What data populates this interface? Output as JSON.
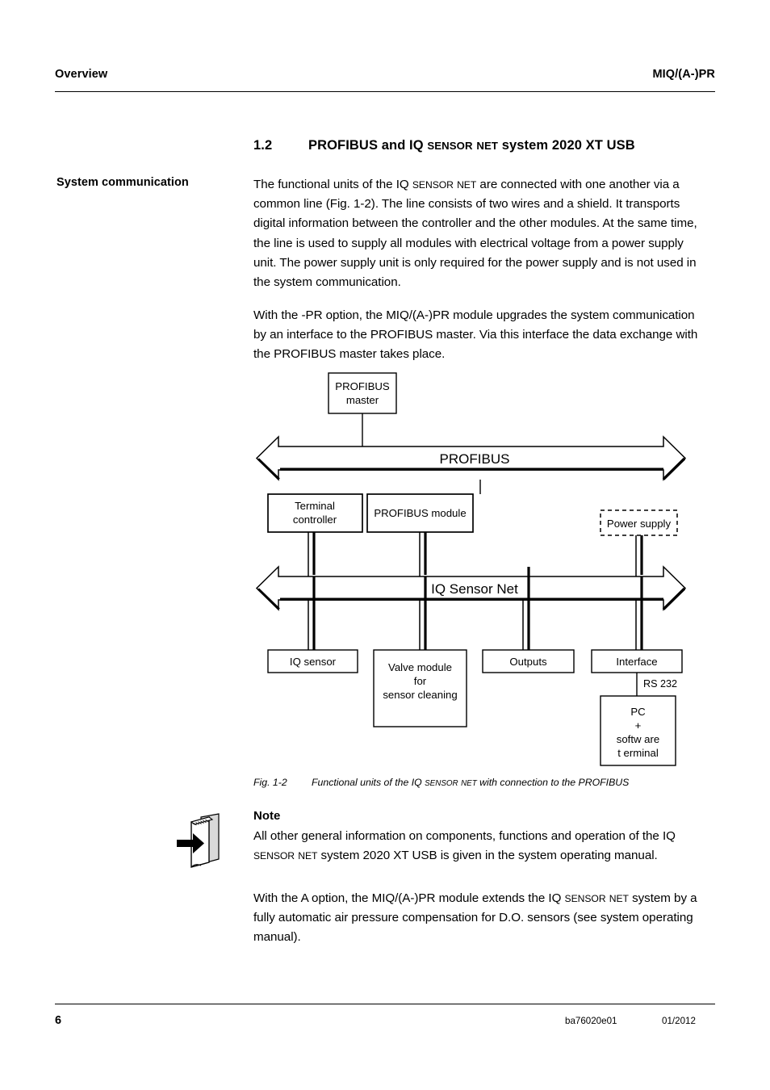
{
  "header": {
    "left": "Overview",
    "right": "MIQ/(A-)PR"
  },
  "heading": {
    "number": "1.2",
    "text_part1": "PROFIBUS and IQ ",
    "text_smallcaps1": "SENSOR",
    "text_part2": " ",
    "text_smallcaps2": "NET",
    "text_part3": " system 2020 XT USB",
    "full": "1.2 PROFIBUS and IQ SENSOR NET system 2020 XT USB"
  },
  "margin_label": "System communication",
  "paragraphs": {
    "p1": "The functional units of the IQ SENSOR NET are connected with one another via a common line (Fig. 1-2). The line consists of two wires and a shield. It transports digital information between the controller and the other modules. At the same time, the line is used to supply all modules with electrical voltage from a power supply unit. The power supply unit is only required for the power supply and is not used in the system communication.",
    "p2": "With the -PR option, the MIQ/(A-)PR module upgrades the system communication by an interface to the PROFIBUS master. Via this interface the data exchange with the PROFIBUS master takes place.",
    "p3": "All other general information on components, functions and operation of the IQ SENSOR NET system 2020 XT USB is given in the system operating manual.",
    "p4": "With the A option, the MIQ/(A-)PR module extends the IQ SENSOR NET system by a fully automatic air pressure compensation for D.O. sensors (see system operating manual)."
  },
  "note": {
    "title": "Note",
    "icon": "book-with-arrow-icon"
  },
  "figure": {
    "caption_number": "Fig. 1-2",
    "caption_text": "Functional units of the IQ SENSOR NET with connection to the PROFIBUS",
    "diagram": {
      "type": "block-diagram",
      "buses": [
        {
          "id": "profibus-bus",
          "label": "PROFIBUS"
        },
        {
          "id": "iq-sensor-net-bus",
          "label": "IQ Sensor Net"
        }
      ],
      "nodes": [
        {
          "id": "profibus-master",
          "label_lines": [
            "PROFIBUS",
            "master"
          ],
          "style": "solid",
          "row": "top"
        },
        {
          "id": "terminal-controller",
          "label_lines": [
            "Terminal",
            "controller"
          ],
          "style": "solid",
          "row": "middle"
        },
        {
          "id": "profibus-module",
          "label_lines": [
            "PROFIBUS module"
          ],
          "style": "solid",
          "row": "middle"
        },
        {
          "id": "power-supply",
          "label_lines": [
            "Power supply"
          ],
          "style": "dashed",
          "row": "middle"
        },
        {
          "id": "iq-sensor",
          "label_lines": [
            "IQ sensor"
          ],
          "style": "solid",
          "row": "bottom"
        },
        {
          "id": "valve-module",
          "label_lines": [
            "Valve module",
            "for",
            "sensor cleaning"
          ],
          "style": "solid",
          "row": "bottom"
        },
        {
          "id": "outputs",
          "label_lines": [
            "Outputs"
          ],
          "style": "solid",
          "row": "bottom"
        },
        {
          "id": "interface",
          "label_lines": [
            "Interface"
          ],
          "style": "solid",
          "row": "bottom"
        },
        {
          "id": "pc-software-terminal",
          "label_lines": [
            "PC",
            "+",
            "softw are",
            "t erminal"
          ],
          "style": "solid",
          "row": "extra"
        }
      ],
      "edge_labels": [
        {
          "id": "rs232-label",
          "text": "RS 232"
        }
      ]
    }
  },
  "footer": {
    "page_number": "6",
    "doc_id": "ba76020e01",
    "date": "01/2012"
  },
  "colors": {
    "ink": "#000000",
    "paper": "#ffffff"
  }
}
